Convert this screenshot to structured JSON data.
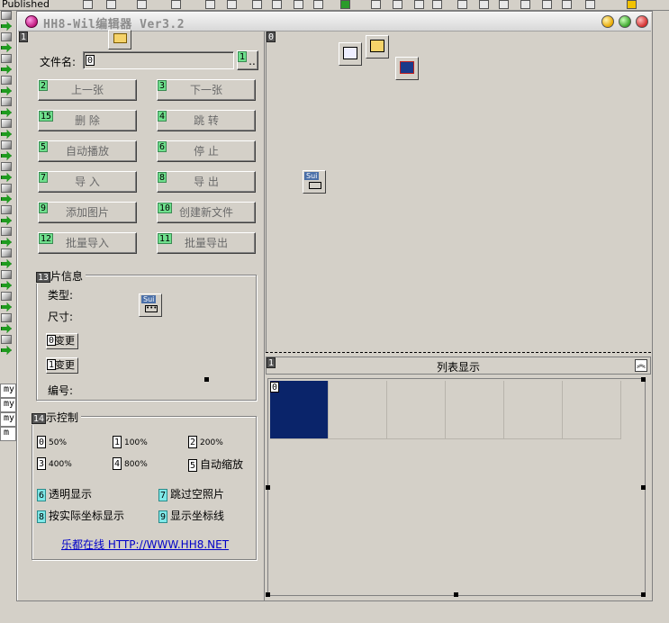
{
  "ide": {
    "published_label": "Published",
    "log_lines": [
      "my",
      "my",
      "my",
      "m"
    ]
  },
  "window": {
    "title": "HH8-Wil编辑器 Ver3.2"
  },
  "left_panel": {
    "panel_tag": "1",
    "filename_label": "文件名:",
    "filename_value": "0",
    "browse_button": {
      "tag": "1",
      "label": ".."
    },
    "buttons": [
      {
        "tag": "2",
        "label": "上一张"
      },
      {
        "tag": "3",
        "label": "下一张"
      },
      {
        "tag": "15",
        "label": "删  除"
      },
      {
        "tag": "4",
        "label": "跳  转"
      },
      {
        "tag": "5",
        "label": "自动播放"
      },
      {
        "tag": "6",
        "label": "停  止"
      },
      {
        "tag": "7",
        "label": "导  入"
      },
      {
        "tag": "8",
        "label": "导  出"
      },
      {
        "tag": "9",
        "label": "添加图片"
      },
      {
        "tag": "10",
        "label": "创建新文件"
      },
      {
        "tag": "12",
        "label": "批量导入"
      },
      {
        "tag": "11",
        "label": "批量导出"
      }
    ],
    "image_info": {
      "tag": "13",
      "title": "片信息",
      "type_label": "类型:",
      "size_label": "尺寸:",
      "change_buttons": [
        {
          "tag": "0",
          "label": "变更"
        },
        {
          "tag": "1",
          "label": "变更"
        }
      ],
      "number_label": "编号:",
      "component_label": "Sui"
    },
    "display_control": {
      "tag": "14",
      "title": "示控制",
      "zoom_options": [
        {
          "tag": "0",
          "label": "50%"
        },
        {
          "tag": "1",
          "label": "100%"
        },
        {
          "tag": "2",
          "label": "200%"
        },
        {
          "tag": "3",
          "label": "400%"
        },
        {
          "tag": "4",
          "label": "800%"
        },
        {
          "tag": "5",
          "label": "自动缩放"
        }
      ],
      "checkboxes": [
        {
          "tag": "6",
          "label": "透明显示"
        },
        {
          "tag": "7",
          "label": "跳过空照片"
        },
        {
          "tag": "8",
          "label": "按实际坐标显示"
        },
        {
          "tag": "9",
          "label": "显示坐标线"
        }
      ],
      "link": "乐都在线 HTTP://WWW.HH8.NET"
    }
  },
  "designer": {
    "panel_tag": "0",
    "component_label": "Sui"
  },
  "list_panel": {
    "tag": "1",
    "title": "列表显示",
    "collapse_glyph": "︽",
    "cell_tag": "0"
  },
  "colors": {
    "face": "#d4d0c8",
    "selected_cell": "#0a246a",
    "tag_green": "#6fe08d",
    "link_blue": "#0000c8"
  }
}
